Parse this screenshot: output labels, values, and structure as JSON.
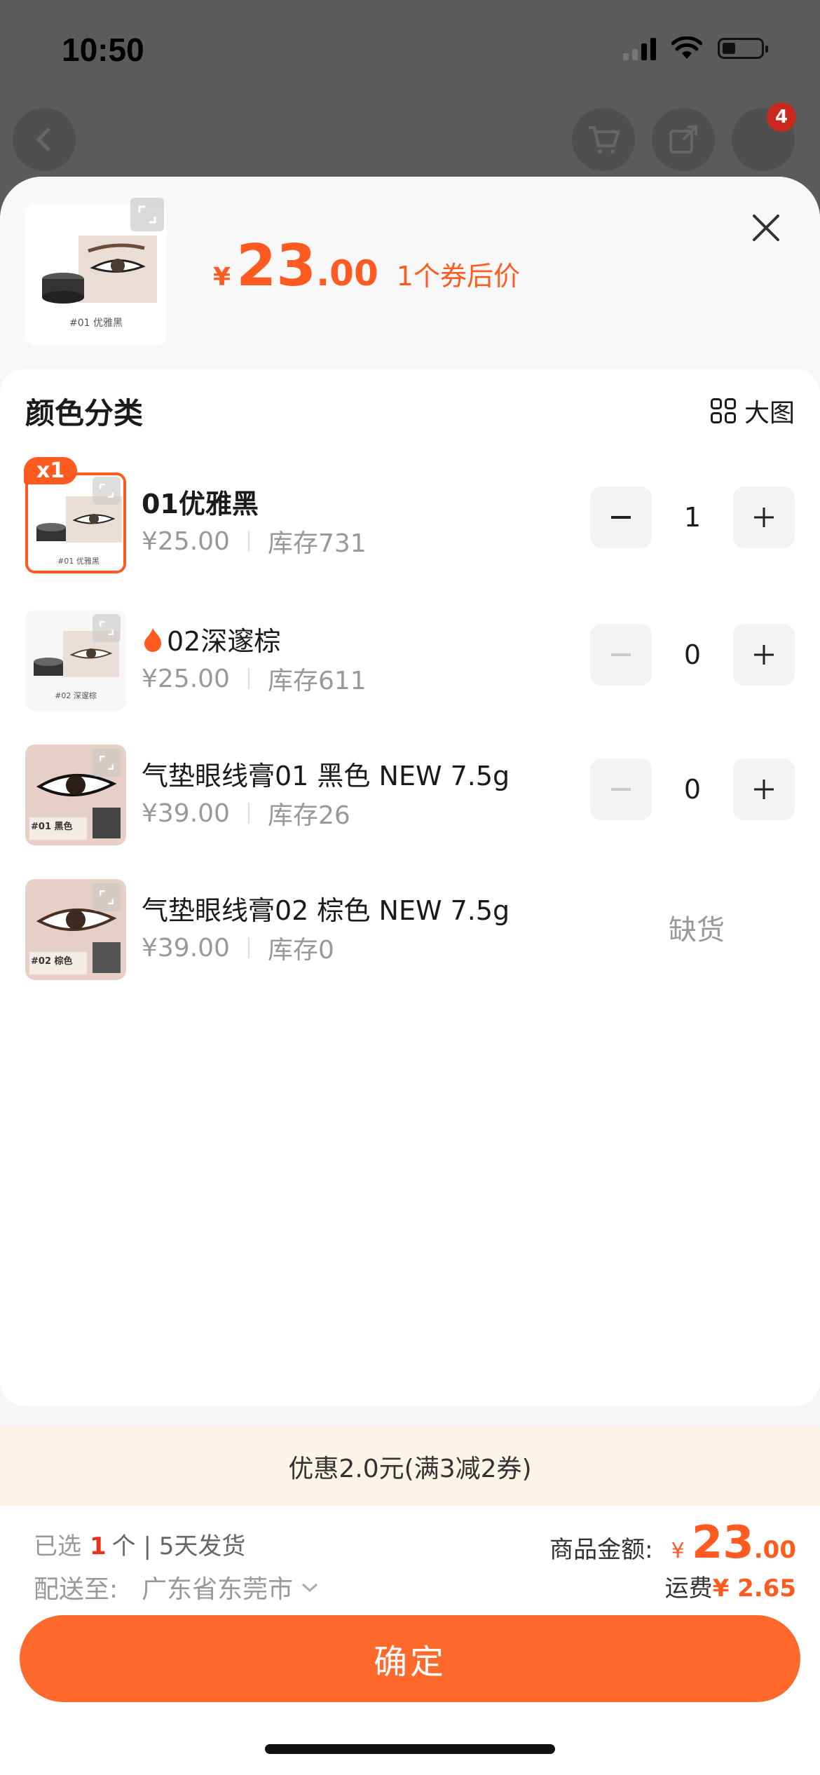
{
  "status": {
    "time": "10:50"
  },
  "nav": {
    "cart_badge": "4"
  },
  "header": {
    "thumb_caption": "#01 优雅黑",
    "price_symbol": "¥",
    "price_int": "23",
    "price_dec": ".00",
    "price_note": "1个券后价"
  },
  "section": {
    "title": "颜色分类",
    "big_image_label": "大图"
  },
  "items": [
    {
      "name": "01优雅黑",
      "price": "¥25.00",
      "stock": "库存731",
      "qty": "1",
      "selected_badge": "x1",
      "caption": "#01 优雅黑"
    },
    {
      "name": "02深邃棕",
      "price": "¥25.00",
      "stock": "库存611",
      "qty": "0",
      "caption": "#02 深邃棕"
    },
    {
      "name": "气垫眼线膏01 黑色 NEW 7.5g",
      "price": "¥39.00",
      "stock": "库存26",
      "qty": "0",
      "caption": "#01 黑色"
    },
    {
      "name": "气垫眼线膏02 棕色 NEW 7.5g",
      "price": "¥39.00",
      "stock": "库存0",
      "status": "缺货",
      "caption": "#02 棕色"
    }
  ],
  "promo": {
    "text": "优惠2.0元(满3减2券)"
  },
  "footer": {
    "selected_prefix": "已选",
    "selected_count": "1",
    "selected_suffix": "个",
    "delivery": "| 5天发货",
    "ship_to_label": "配送至:",
    "ship_to_value": "广东省东莞市",
    "amount_label": "商品金额:",
    "amount_symbol": "¥",
    "amount_int": "23",
    "amount_dec": ".00",
    "shipping_label": "运费",
    "shipping_value": "¥ 2.65",
    "confirm": "确定"
  },
  "colors": {
    "accent": "#ff5a1f",
    "button": "#ff6a2c",
    "promo_bg": "#fdf4e8"
  }
}
